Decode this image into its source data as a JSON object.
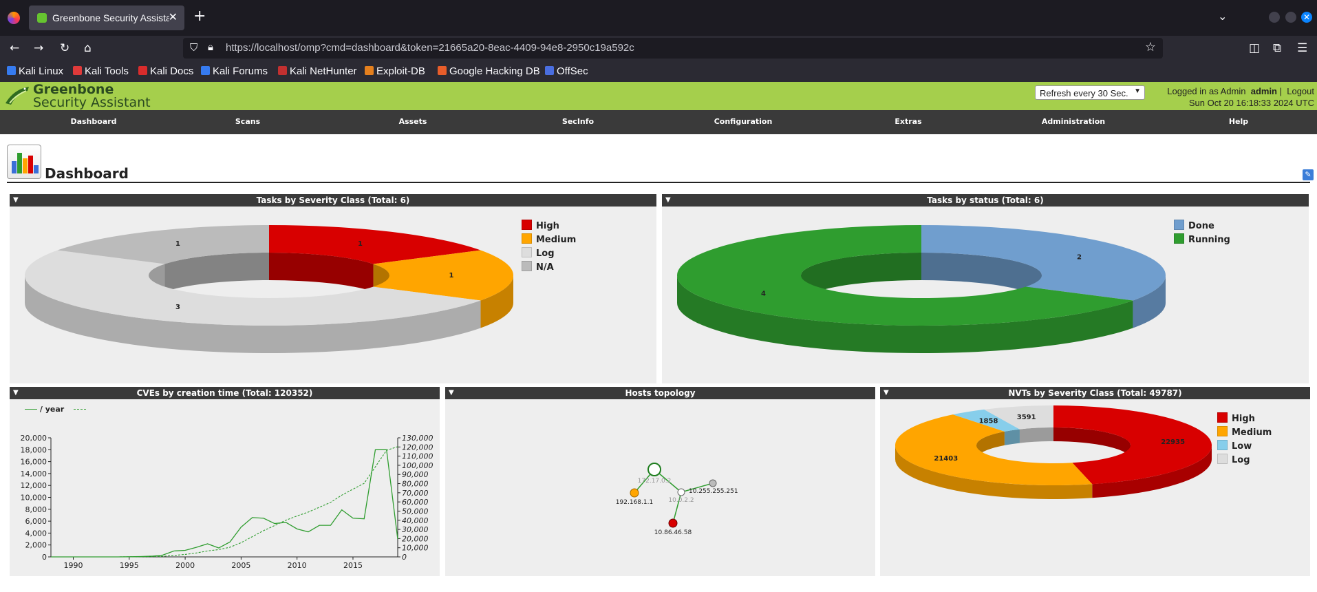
{
  "browser": {
    "tab_title": "Greenbone Security Assistant",
    "url": "https://localhost/omp?cmd=dashboard&token=21665a20-8eac-4409-94e8-2950c19a592c",
    "bookmarks": [
      "Kali Linux",
      "Kali Tools",
      "Kali Docs",
      "Kali Forums",
      "Kali NetHunter",
      "Exploit-DB",
      "Google Hacking DB",
      "OffSec"
    ]
  },
  "app": {
    "brand_line1": "Greenbone",
    "brand_line2": "Security Assistant",
    "refresh_select": "Refresh every 30 Sec.",
    "logged_in_label": "Logged in as  Admin",
    "username": "admin",
    "logout": "Logout",
    "datetime": "Sun Oct 20 16:18:33 2024 UTC"
  },
  "menu": [
    "Dashboard",
    "Scans",
    "Assets",
    "SecInfo",
    "Configuration",
    "Extras",
    "Administration",
    "Help"
  ],
  "page_title": "Dashboard",
  "panels": {
    "severity_title": "Tasks by Severity Class (Total: 6)",
    "status_title": "Tasks by status (Total: 6)",
    "cves_title": "CVEs by creation time (Total: 120352)",
    "topology_title": "Hosts topology",
    "nvts_title": "NVTs by Severity Class (Total: 49787)",
    "cves_legend": "/ year"
  },
  "chart_data": [
    {
      "type": "pie",
      "title": "Tasks by Severity Class (Total: 6)",
      "categories": [
        "High",
        "Medium",
        "Log",
        "N/A"
      ],
      "values": [
        1,
        1,
        3,
        1
      ],
      "colors": [
        "#d80000",
        "#ffa500",
        "#dddddd",
        "#bbbbbb"
      ]
    },
    {
      "type": "pie",
      "title": "Tasks by status (Total: 6)",
      "categories": [
        "Done",
        "Running"
      ],
      "values": [
        2,
        4
      ],
      "colors": [
        "#709ece",
        "#2f9d2f"
      ]
    },
    {
      "type": "line",
      "title": "CVEs by creation time (Total: 120352)",
      "x": [
        1988,
        1989,
        1990,
        1991,
        1992,
        1993,
        1994,
        1995,
        1996,
        1997,
        1998,
        1999,
        2000,
        2001,
        2002,
        2003,
        2004,
        2005,
        2006,
        2007,
        2008,
        2009,
        2010,
        2011,
        2012,
        2013,
        2014,
        2015,
        2016,
        2017,
        2018,
        2019
      ],
      "series": [
        {
          "name": "/ year",
          "axis": "left",
          "values": [
            0,
            0,
            0,
            0,
            0,
            0,
            0,
            20,
            50,
            120,
            300,
            1000,
            1100,
            1600,
            2200,
            1500,
            2500,
            5000,
            6600,
            6500,
            5600,
            5800,
            4700,
            4200,
            5300,
            5300,
            7900,
            6500,
            6400,
            18000,
            18000,
            3000
          ]
        },
        {
          "axis": "right",
          "values": [
            0,
            0,
            0,
            0,
            0,
            0,
            0,
            100,
            200,
            300,
            600,
            1600,
            2700,
            4300,
            6500,
            8000,
            10500,
            15500,
            22100,
            28600,
            34200,
            40000,
            44700,
            48900,
            54200,
            59500,
            67400,
            73900,
            80300,
            98300,
            116300,
            120352
          ]
        }
      ],
      "ylim": [
        0,
        20000
      ],
      "y2lim": [
        0,
        130000
      ],
      "x_ticks": [
        1990,
        1995,
        2000,
        2005,
        2010,
        2015
      ],
      "y_ticks": [
        "0",
        "2,000",
        "4,000",
        "6,000",
        "8,000",
        "10,000",
        "12,000",
        "14,000",
        "16,000",
        "18,000",
        "20,000"
      ],
      "y2_ticks": [
        "0",
        "10,000",
        "20,000",
        "30,000",
        "40,000",
        "50,000",
        "60,000",
        "70,000",
        "80,000",
        "90,000",
        "100,000",
        "110,000",
        "120,000",
        "130,000"
      ],
      "legend": "top-left"
    },
    {
      "type": "pie",
      "title": "NVTs by Severity Class (Total: 49787)",
      "categories": [
        "High",
        "Medium",
        "Low",
        "Log"
      ],
      "values": [
        22935,
        21403,
        1858,
        3591
      ],
      "colors": [
        "#d80000",
        "#ffa500",
        "#87ceeb",
        "#dddddd"
      ]
    }
  ],
  "topology": {
    "nodes": [
      "172.17.0.2",
      "192.168.1.1",
      "10.0.2.2",
      "10.255.255.251",
      "10.86.46.58"
    ]
  }
}
